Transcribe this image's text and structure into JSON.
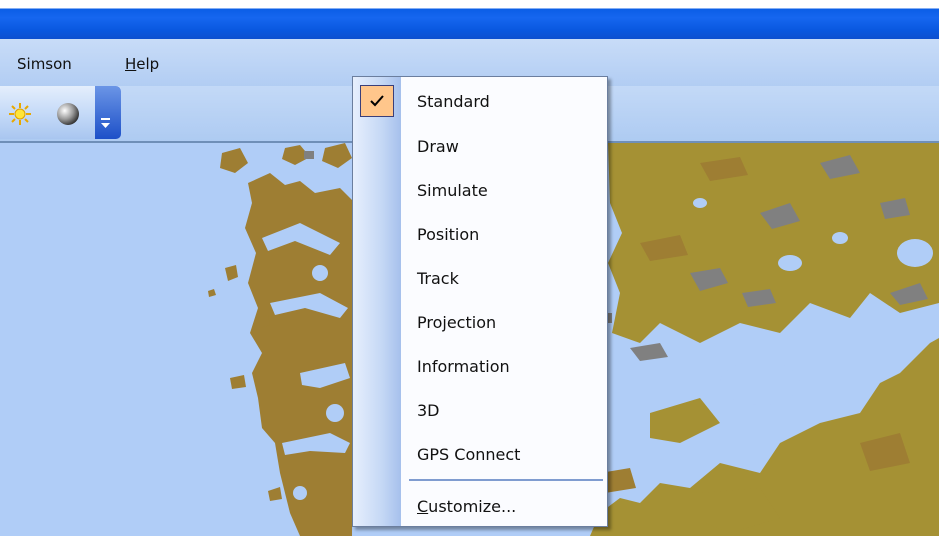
{
  "menubar": {
    "items": [
      {
        "label": "Simson"
      },
      {
        "label_prefix": "",
        "label_underlined": "H",
        "label_rest": "elp"
      }
    ]
  },
  "toolbar": {
    "buttons": [
      {
        "icon": "sun-icon"
      },
      {
        "icon": "sphere-icon"
      },
      {
        "icon": "chevron-down-icon"
      }
    ]
  },
  "context_menu": {
    "items": [
      {
        "label": "Standard",
        "checked": true
      },
      {
        "label": "Draw",
        "checked": false
      },
      {
        "label": "Simulate",
        "checked": false
      },
      {
        "label": "Position",
        "checked": false
      },
      {
        "label": "Track",
        "checked": false
      },
      {
        "label": "Projection",
        "checked": false
      },
      {
        "label": "Information",
        "checked": false
      },
      {
        "label": "3D",
        "checked": false
      },
      {
        "label": "GPS Connect",
        "checked": false
      }
    ],
    "customize": {
      "underlined": "C",
      "rest": "ustomize..."
    }
  },
  "colors": {
    "water": "#b0cdf7",
    "land": "#9e7e33",
    "land_alt": "#a59134",
    "rock": "#808080",
    "checked_bg": "#ffc68b",
    "title_blue": "#0b5ee6"
  }
}
